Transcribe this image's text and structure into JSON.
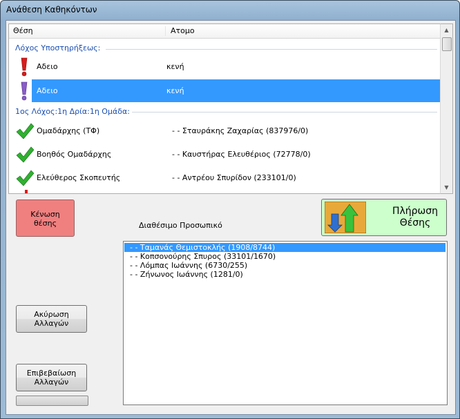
{
  "window": {
    "title": "Ανάθεση Καθηκόντων"
  },
  "table": {
    "columns": [
      "Θέση",
      "Ατομο"
    ],
    "groups": [
      {
        "label": "Λόχος Υποστηρήξεως:"
      },
      {
        "label": "1ος Λόχος:1η Δρία:1η Ομάδα:"
      }
    ],
    "rows": [
      {
        "position": "Αδειο",
        "person": "κενή",
        "icon": "red-exclamation-icon",
        "selected": false
      },
      {
        "position": "Αδειο",
        "person": "κενή",
        "icon": "purple-exclamation-icon",
        "selected": true
      },
      {
        "position": "Ομαδάρχης (ΤΦ)",
        "person": "- - Σταυράκης Ζαχαρίας (837976/0)",
        "icon": "green-check-icon",
        "selected": false
      },
      {
        "position": "Βοηθός Ομαδάρχης",
        "person": "- - Καυστήρας Ελευθέριος (72778/0)",
        "icon": "green-check-icon",
        "selected": false
      },
      {
        "position": "Ελεύθερος Σκοπευτής",
        "person": "- - Αντρέου Σπυρίδον (233101/0)",
        "icon": "green-check-icon",
        "selected": false
      }
    ]
  },
  "buttons": {
    "empty_position": [
      "Κένωση",
      "θέσης"
    ],
    "fill_position": [
      "Πλήρωση",
      "Θέσης"
    ],
    "cancel_changes": [
      "Ακύρωση",
      "Αλλαγών"
    ],
    "confirm_changes": [
      "Επιβεβαίωση",
      "Αλλαγών"
    ]
  },
  "available": {
    "label": "Διαθέσιμο Προσωπικό",
    "items": [
      {
        "text": "- - Ταμανάς Θεμιστοκλής (1908/8744)",
        "selected": true
      },
      {
        "text": "- - Κοπσονούρης Σπυρος (33101/1670)",
        "selected": false
      },
      {
        "text": "- - Λόμπας Ιωάννης (6730/255)",
        "selected": false
      },
      {
        "text": "- - Ζήνωνος Ιωάννης (1281/0)",
        "selected": false
      }
    ]
  },
  "colors": {
    "selection": "#3399ff",
    "group_text": "#1b4fb3",
    "empty_button": "#f08080",
    "fill_button": "#ccffcc"
  }
}
